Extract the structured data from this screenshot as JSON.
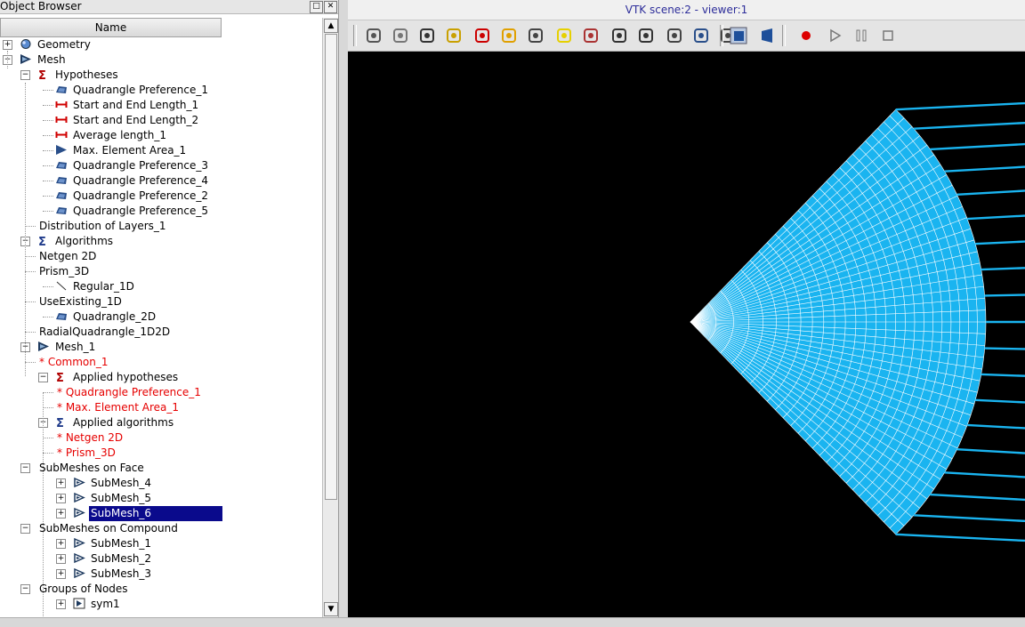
{
  "object_browser": {
    "title": "Object Browser",
    "column_header": "Name",
    "items": [
      {
        "label": "Geometry"
      },
      {
        "label": "Mesh"
      },
      {
        "label": "Hypotheses"
      },
      {
        "label": "Quadrangle Preference_1"
      },
      {
        "label": "Start and End Length_1"
      },
      {
        "label": "Start and End Length_2"
      },
      {
        "label": "Average length_1"
      },
      {
        "label": "Max. Element Area_1"
      },
      {
        "label": "Quadrangle Preference_3"
      },
      {
        "label": "Quadrangle Preference_4"
      },
      {
        "label": "Quadrangle Preference_2"
      },
      {
        "label": "Quadrangle Preference_5"
      },
      {
        "label": "Distribution of Layers_1"
      },
      {
        "label": "Algorithms"
      },
      {
        "label": "Netgen 2D"
      },
      {
        "label": "Prism_3D"
      },
      {
        "label": "Regular_1D"
      },
      {
        "label": "UseExisting_1D"
      },
      {
        "label": "Quadrangle_2D"
      },
      {
        "label": "RadialQuadrangle_1D2D"
      },
      {
        "label": "Mesh_1"
      },
      {
        "label": "* Common_1"
      },
      {
        "label": "Applied hypotheses"
      },
      {
        "label": "* Quadrangle Preference_1"
      },
      {
        "label": "* Max. Element Area_1"
      },
      {
        "label": "Applied algorithms"
      },
      {
        "label": "* Netgen 2D"
      },
      {
        "label": "* Prism_3D"
      },
      {
        "label": "SubMeshes on Face"
      },
      {
        "label": "SubMesh_4"
      },
      {
        "label": "SubMesh_5"
      },
      {
        "label": "SubMesh_6"
      },
      {
        "label": "SubMeshes on Compound"
      },
      {
        "label": "SubMesh_1"
      },
      {
        "label": "SubMesh_2"
      },
      {
        "label": "SubMesh_3"
      },
      {
        "label": "Groups of Nodes"
      },
      {
        "label": "sym1"
      }
    ]
  },
  "viewer": {
    "title": "VTK scene:2 - viewer:1",
    "mesh_color": "#1ab4f0",
    "toolbar": [
      "dump-view-icon",
      "interaction-style-icon",
      "show-axes-icon",
      "zoom-icon",
      "pan-icon",
      "rotate-icon",
      "spin-icon",
      "fit-all-icon",
      "fit-area-icon",
      "global-pan-icon",
      "lod-icon",
      "graduated-axes-icon",
      "clipping-icon",
      "bounding-box-icon",
      "parallel-projection-icon",
      "perspective-projection-icon",
      "record-icon",
      "play-icon",
      "pause-icon",
      "stop-icon"
    ]
  },
  "colors": {
    "selection": "#0a0a8c",
    "applied": "#e60000",
    "title_text": "#2d2d9a"
  }
}
